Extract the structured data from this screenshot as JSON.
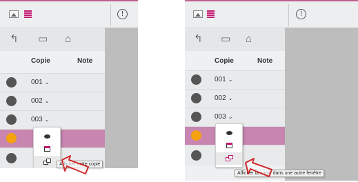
{
  "toolbar": {
    "image_icon": "image-icon",
    "list_icon": "list-icon",
    "info_icon": "info-icon",
    "info_glyph": "!"
  },
  "nav": {
    "back_glyph": "↰",
    "folder_glyph": "▭",
    "home_glyph": "⌂"
  },
  "columns": {
    "copie": "Copie",
    "note": "Note"
  },
  "rows": [
    {
      "label": "001"
    },
    {
      "label": "002"
    },
    {
      "label": "003"
    }
  ],
  "chevron": "⌄",
  "popup_left": {
    "items": [
      "eye-icon",
      "window-icon",
      "windows-icon"
    ]
  },
  "tooltip_left": "Afficher cette copie",
  "tooltip_right": "Afficher la copie dans une autre fenêtre",
  "colors": {
    "accent": "#c0176f",
    "selected_row": "#c785b0",
    "status_orange": "#f4a20e",
    "status_gray": "#555555"
  }
}
